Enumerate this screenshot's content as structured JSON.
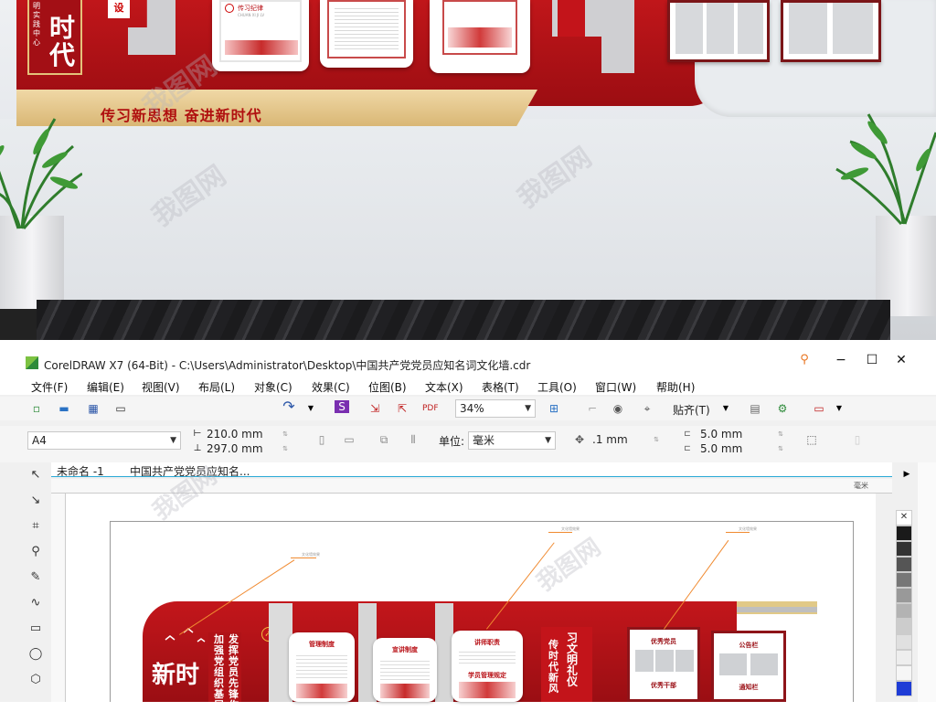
{
  "scene": {
    "banner_slogan": "传习新思想  奋进新时代",
    "plaque_big": "时代",
    "plaque_vertical": "明实践中心",
    "tag_red": "设",
    "board_heading": "传习纪律",
    "board_subheading": "CHUAN XI JI LV",
    "watermark": "我图网"
  },
  "window": {
    "title": "CorelDRAW X7 (64-Bit) - C:\\Users\\Administrator\\Desktop\\中国共产党党员应知名词文化墙.cdr",
    "minimize": "−",
    "maximize": "☐",
    "close": "✕"
  },
  "menu": [
    "文件(F)",
    "编辑(E)",
    "视图(V)",
    "布局(L)",
    "对象(C)",
    "效果(C)",
    "位图(B)",
    "文本(X)",
    "表格(T)",
    "工具(O)",
    "窗口(W)",
    "帮助(H)"
  ],
  "toolbar": {
    "zoom": "34%",
    "snap": "贴齐(T)"
  },
  "property_bar": {
    "page_size": "A4",
    "width": "210.0 mm",
    "height": "297.0 mm",
    "unit_label": "单位:",
    "unit_value": "毫米",
    "nudge": ".1 mm",
    "dup_x": "5.0 mm",
    "dup_y": "5.0 mm"
  },
  "doc_tabs": [
    "未命名 -1",
    "中国共产党党员应知名..."
  ],
  "ruler_unit": "毫米",
  "icons": [
    "pick-tool-icon",
    "shape-tool-icon",
    "crop-tool-icon",
    "zoom-tool-icon",
    "freehand-tool-icon",
    "artistic-media-icon",
    "rectangle-tool-icon",
    "ellipse-tool-icon"
  ],
  "design": {
    "left_title": "新时",
    "column1": "加强党组织基层建",
    "column2": "发挥党员先锋作用",
    "panel1_title": "管理制度",
    "panel2_title": "宣讲制度",
    "panel3_title": "讲师职责",
    "panel3_sub": "学员管理规定",
    "column3": "传时代新风",
    "column4": "习文明礼仪",
    "notice1_title": "优秀党员",
    "notice1_sub": "优秀干部",
    "notice2_title": "公告栏",
    "notice2_sub": "通知栏",
    "callout": "文化墙效果"
  },
  "palette_colors": [
    "#ffffff",
    "#1a1a1a",
    "#333333",
    "#555555",
    "#777777",
    "#999999",
    "#b3b3b3",
    "#cccccc",
    "#e0e0e0",
    "#eeeeee",
    "#f6f6f6",
    "#ffffff",
    "#1e3cd6"
  ]
}
